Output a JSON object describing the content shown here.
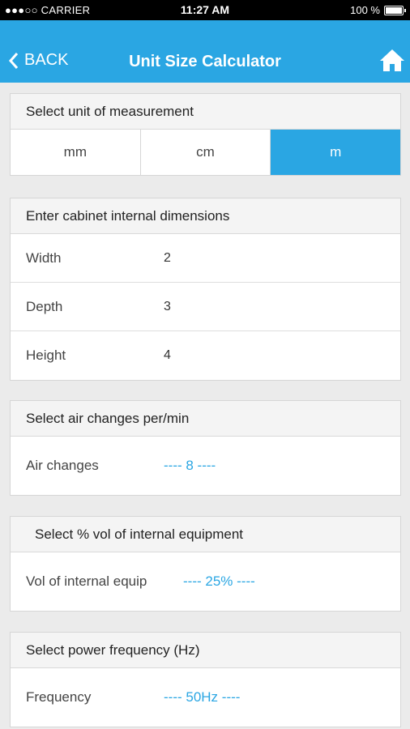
{
  "status_bar": {
    "carrier": "●●●○○ CARRIER",
    "time": "11:27 AM",
    "battery": "100 %"
  },
  "navbar": {
    "back_label": "BACK",
    "title": "Unit Size Calculator"
  },
  "unit": {
    "header": "Select unit of measurement",
    "options": [
      "mm",
      "cm",
      "m"
    ],
    "selected": "m"
  },
  "dimensions": {
    "header": "Enter cabinet internal dimensions",
    "rows": [
      {
        "label": "Width",
        "value": "2"
      },
      {
        "label": "Depth",
        "value": "3"
      },
      {
        "label": "Height",
        "value": "4"
      }
    ]
  },
  "air": {
    "header": "Select air changes per/min",
    "label": "Air changes",
    "value": "---- 8 ----"
  },
  "equip": {
    "header": "Select % vol of internal equipment",
    "label": "Vol of internal equip",
    "value": "---- 25% ----"
  },
  "freq": {
    "header": "Select power frequency (Hz)",
    "label": "Frequency",
    "value": "---- 50Hz ----"
  },
  "colors": {
    "accent": "#2aa6e3",
    "background": "#ebebeb"
  }
}
